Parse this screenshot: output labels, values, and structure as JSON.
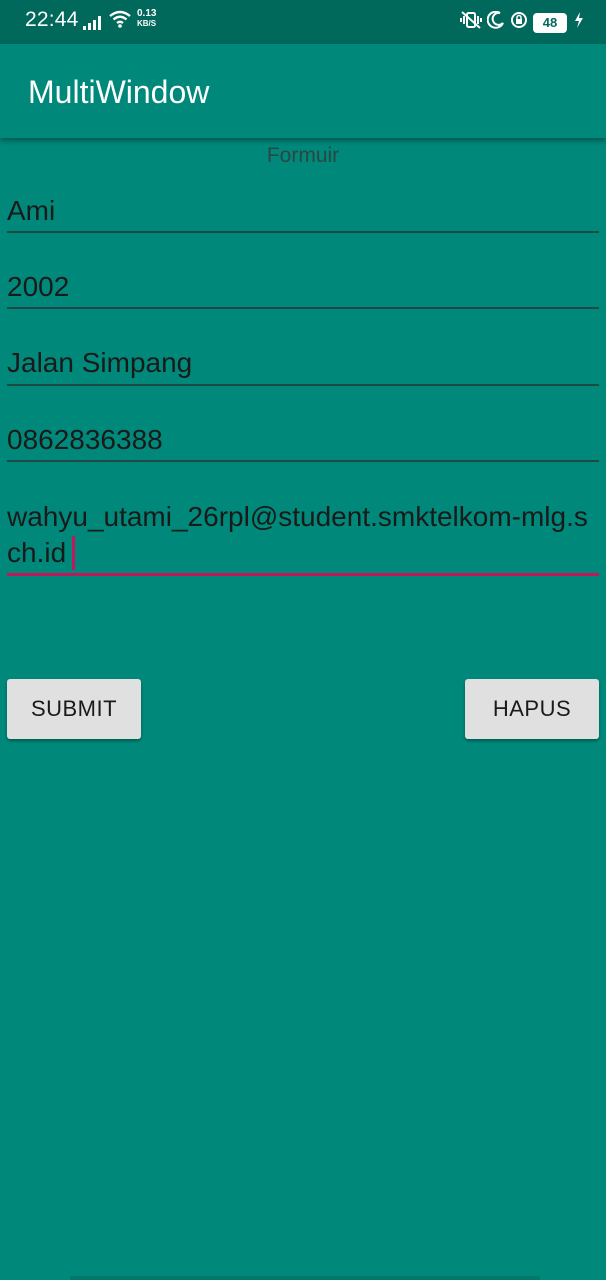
{
  "status_bar": {
    "time": "22:44",
    "speed_value": "0.13",
    "speed_unit": "KB/S",
    "battery": "48",
    "icons": [
      "signal-icon",
      "wifi-icon",
      "vibrate-icon",
      "moon-icon",
      "alarm-icon",
      "battery-icon",
      "charging-bolt-icon"
    ]
  },
  "app_bar": {
    "title": "MultiWindow"
  },
  "form": {
    "heading": "Formuir",
    "fields": [
      {
        "value": "Ami"
      },
      {
        "value": "2002"
      },
      {
        "value": "Jalan Simpang"
      },
      {
        "value": "0862836388"
      },
      {
        "value": "wahyu_utami_26rpl@student.smktelkom-mlg.sch.id"
      }
    ]
  },
  "buttons": {
    "submit": "SUBMIT",
    "hapus": "HAPUS"
  },
  "colors": {
    "background": "#00897b",
    "status_bar": "#00695c",
    "accent": "#c2185b",
    "button": "#e0e0e0"
  }
}
